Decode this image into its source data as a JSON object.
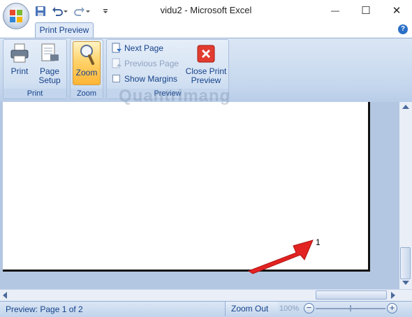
{
  "window": {
    "title": "vidu2 - Microsoft Excel",
    "minimize": "—",
    "maximize": "☐",
    "close": "✕"
  },
  "quick_access": {
    "save_icon": "save-icon",
    "undo_icon": "undo-icon",
    "redo_icon": "redo-icon",
    "customize_icon": "customize-qat-icon"
  },
  "tabs": {
    "active": "Print Preview",
    "help": "?"
  },
  "ribbon": {
    "print_group": {
      "label": "Print",
      "print_btn": "Print",
      "page_setup_btn_line1": "Page",
      "page_setup_btn_line2": "Setup"
    },
    "zoom_group": {
      "label": "Zoom",
      "zoom_btn": "Zoom"
    },
    "preview_group": {
      "label": "Preview",
      "next_page": "Next Page",
      "previous_page": "Previous Page",
      "show_margins": "Show Margins",
      "close_line1": "Close Print",
      "close_line2": "Preview"
    }
  },
  "document": {
    "page_number": "1"
  },
  "watermark": "Quantrimang",
  "statusbar": {
    "status": "Preview: Page 1 of 2",
    "zoom_out": "Zoom Out",
    "zoom_level": "100%",
    "minus": "−",
    "plus": "+"
  },
  "colors": {
    "accent": "#15428b",
    "ribbon": "#c6d8ee",
    "arrow": "#e32222"
  }
}
